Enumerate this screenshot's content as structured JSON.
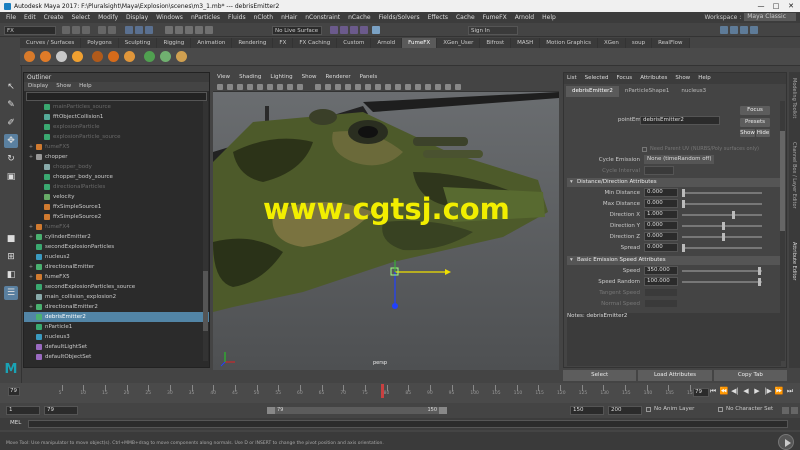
{
  "window": {
    "title": "Autodesk Maya 2017: F:\\Pluralsight\\Maya\\Explosion\\scenes\\m3_1.mb*  ---  debrisEmitter2",
    "controls": [
      "—",
      "□",
      "✕"
    ]
  },
  "menubar": {
    "items": [
      "File",
      "Edit",
      "Create",
      "Select",
      "Modify",
      "Display",
      "Windows",
      "nParticles",
      "Fluids",
      "nCloth",
      "nHair",
      "nConstraint",
      "nCache",
      "Fields/Solvers",
      "Effects",
      "Cache",
      "FumeFX",
      "Arnold",
      "Help"
    ],
    "workspace_label": "Workspace :",
    "workspace_value": "Maya Classic"
  },
  "statusline": {
    "menuset": "FX",
    "live_surface": "No Live Surface",
    "signin": "Sign In"
  },
  "shelf": {
    "tabs": [
      "Curves / Surfaces",
      "Polygons",
      "Sculpting",
      "Rigging",
      "Animation",
      "Rendering",
      "FX",
      "FX Caching",
      "Custom",
      "Arnold",
      "FumeFX",
      "XGen_User",
      "Bifrost",
      "MASH",
      "Motion Graphics",
      "XGen",
      "soup",
      "RealFlow"
    ],
    "active_tab": "FumeFX"
  },
  "outliner": {
    "title": "Outliner",
    "menu": [
      "Display",
      "Show",
      "Help"
    ],
    "rows": [
      {
        "label": "mainParticles_source",
        "indent": 2,
        "dim": true,
        "icon": "particle"
      },
      {
        "label": "fftObjectCollision1",
        "indent": 2,
        "dim": false,
        "icon": "collision"
      },
      {
        "label": "explosionParticle",
        "indent": 2,
        "dim": true,
        "icon": "particle"
      },
      {
        "label": "explosionParticle_source",
        "indent": 2,
        "dim": true,
        "icon": "particle"
      },
      {
        "label": "fumeFX5",
        "indent": 1,
        "dim": true,
        "icon": "fume",
        "expand": "+"
      },
      {
        "label": "chopper",
        "indent": 1,
        "dim": false,
        "icon": "group",
        "expand": "+"
      },
      {
        "label": "chopper_body",
        "indent": 2,
        "dim": true,
        "icon": "mesh"
      },
      {
        "label": "chopper_body_source",
        "indent": 2,
        "dim": false,
        "icon": "particle"
      },
      {
        "label": "directionalParticles",
        "indent": 2,
        "dim": true,
        "icon": "particle"
      },
      {
        "label": "velocity",
        "indent": 2,
        "dim": false,
        "icon": "field"
      },
      {
        "label": "ffxSimpleSource1",
        "indent": 2,
        "dim": false,
        "icon": "fume"
      },
      {
        "label": "ffxSimpleSource2",
        "indent": 2,
        "dim": false,
        "icon": "fume"
      },
      {
        "label": "fumeFX4",
        "indent": 1,
        "dim": true,
        "icon": "fume",
        "expand": "+"
      },
      {
        "label": "cylinderEmitter2",
        "indent": 1,
        "dim": false,
        "icon": "emitter",
        "expand": "+"
      },
      {
        "label": "secondExplosionParticles",
        "indent": 1,
        "dim": false,
        "icon": "particle"
      },
      {
        "label": "nucleus2",
        "indent": 1,
        "dim": false,
        "icon": "nucleus"
      },
      {
        "label": "directionalEmitter",
        "indent": 1,
        "dim": false,
        "icon": "emitter",
        "expand": "+"
      },
      {
        "label": "fumeFX5",
        "indent": 1,
        "dim": false,
        "icon": "fume",
        "expand": "+"
      },
      {
        "label": "secondExplosionParticles_source",
        "indent": 1,
        "dim": false,
        "icon": "particle"
      },
      {
        "label": "main_collision_explosion2",
        "indent": 1,
        "dim": false,
        "icon": "mesh"
      },
      {
        "label": "directionalEmitter2",
        "indent": 1,
        "dim": false,
        "icon": "emitter",
        "expand": "+"
      },
      {
        "label": "debrisEmitter2",
        "indent": 1,
        "dim": false,
        "icon": "emitter",
        "selected": true
      },
      {
        "label": "nParticle1",
        "indent": 1,
        "dim": false,
        "icon": "particle"
      },
      {
        "label": "nucleus3",
        "indent": 1,
        "dim": false,
        "icon": "nucleus"
      },
      {
        "label": "defaultLightSet",
        "indent": 1,
        "dim": false,
        "icon": "set"
      },
      {
        "label": "defaultObjectSet",
        "indent": 1,
        "dim": false,
        "icon": "set"
      }
    ]
  },
  "viewport": {
    "menu": [
      "View",
      "Shading",
      "Lighting",
      "Show",
      "Renderer",
      "Panels"
    ],
    "camera_label": "persp",
    "watermark": "www.cgtsj.com"
  },
  "attribute_editor": {
    "menu": [
      "List",
      "Selected",
      "Focus",
      "Attributes",
      "Show",
      "Help"
    ],
    "tabs": [
      "debrisEmitter2",
      "nParticleShape1",
      "nucleus3"
    ],
    "active_tab": "debrisEmitter2",
    "node_type_label": "pointEmitter:",
    "node_name": "debrisEmitter2",
    "buttons": {
      "focus": "Focus",
      "presets": "Presets",
      "show": "Show",
      "hide": "Hide"
    },
    "need_parent_uv": "Need Parent UV (NURBS/Poly surfaces only)",
    "cycle_emission_label": "Cycle Emission",
    "cycle_emission_value": "None (timeRandom off)",
    "cycle_interval_label": "Cycle Interval",
    "section_distance": "Distance/Direction Attributes",
    "min_distance_label": "Min Distance",
    "min_distance": "0.000",
    "max_distance_label": "Max Distance",
    "max_distance": "0.000",
    "dir_x_label": "Direction X",
    "dir_x": "1.000",
    "dir_y_label": "Direction Y",
    "dir_y": "0.000",
    "dir_z_label": "Direction Z",
    "dir_z": "0.000",
    "spread_label": "Spread",
    "spread": "0.000",
    "section_speed": "Basic Emission Speed Attributes",
    "speed_label": "Speed",
    "speed": "350.000",
    "speed_random_label": "Speed Random",
    "speed_random": "100.000",
    "tangent_speed_label": "Tangent Speed",
    "normal_speed_label": "Normal Speed",
    "notes_label": "Notes: debrisEmitter2",
    "bottom_buttons": [
      "Select",
      "Load Attributes",
      "Copy Tab"
    ]
  },
  "side_tabs": [
    "Modeling Toolkit",
    "Channel Box / Layer Editor",
    "Attribute Editor"
  ],
  "time_slider": {
    "tick_labels": [
      "5",
      "10",
      "15",
      "20",
      "25",
      "30",
      "35",
      "40",
      "45",
      "50",
      "55",
      "60",
      "65",
      "70",
      "75",
      "80",
      "85",
      "90",
      "95",
      "100",
      "105",
      "110",
      "115",
      "120",
      "125",
      "130",
      "135",
      "140",
      "145",
      "150"
    ],
    "first_frame": "79",
    "current_frame": "79",
    "playback_glyphs": [
      "⏮",
      "⏪",
      "◀|",
      "◀",
      "▶",
      "|▶",
      "⏩",
      "⏭"
    ]
  },
  "range_slider": {
    "start": "1",
    "playback_start": "79",
    "range_start_label": "79",
    "range_end_label": "150",
    "playback_end": "150",
    "end": "200",
    "anim_layer": "No Anim Layer",
    "character_set": "No Character Set"
  },
  "mel": {
    "label": "MEL"
  },
  "helpline": {
    "text": "Move Tool: Use manipulator to move object(s). Ctrl+MMB+drag to move components along normals. Use D or INSERT to change the pivot position and axis orientation."
  }
}
